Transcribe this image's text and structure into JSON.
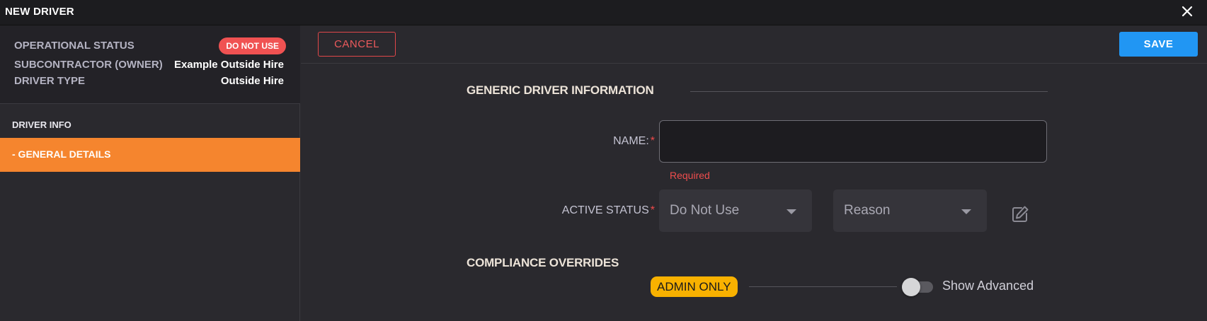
{
  "window": {
    "title": "NEW DRIVER",
    "close_icon": "close-icon"
  },
  "summary": {
    "operational_status": {
      "label": "OPERATIONAL STATUS",
      "badge": "DO NOT USE"
    },
    "subcontractor": {
      "label": "SUBCONTRACTOR (OWNER)",
      "value": "Example Outside Hire"
    },
    "driver_type": {
      "label": "DRIVER TYPE",
      "value": "Outside Hire"
    }
  },
  "sidebar": {
    "section_title": "DRIVER INFO",
    "items": [
      {
        "label": "-  GENERAL DETAILS",
        "active": true
      }
    ]
  },
  "toolbar": {
    "cancel_label": "CANCEL",
    "save_label": "SAVE"
  },
  "form": {
    "section_heading": "GENERIC DRIVER INFORMATION",
    "name": {
      "label": "NAME:",
      "required_marker": "*",
      "value": "",
      "error": "Required"
    },
    "active_status": {
      "label": "ACTIVE STATUS",
      "required_marker": "*",
      "status_value": "Do Not Use",
      "reason_value": "Reason",
      "edit_icon": "edit-icon"
    }
  },
  "compliance": {
    "heading": "COMPLIANCE OVERRIDES",
    "badge": "ADMIN ONLY",
    "toggle_label": "Show Advanced",
    "toggle_on": false
  },
  "colors": {
    "accent_orange": "#f5852e",
    "save_blue": "#2196f3",
    "danger_red": "#f05252",
    "admin_yellow": "#f8b100"
  }
}
